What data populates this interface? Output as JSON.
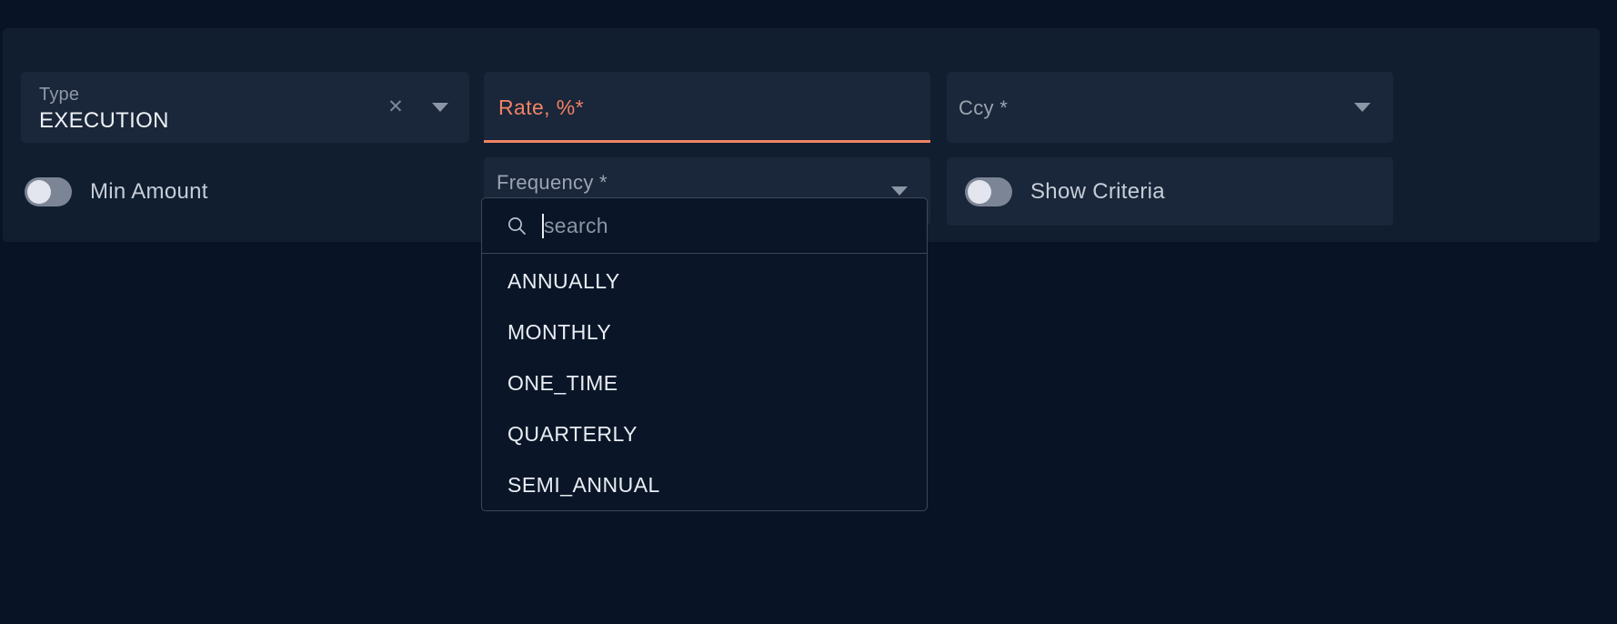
{
  "theme": {
    "page_background": "#081426",
    "panel_background": "#111e30",
    "field_background": "#1a2639",
    "dropdown_background": "#0a1628",
    "dropdown_border": "#3c4758",
    "error_accent": "#ef8364",
    "text_primary": "#eef1f6",
    "text_muted": "#8e99a8",
    "toggle_track": "#7b8595",
    "toggle_knob": "#e3e6ef"
  },
  "form": {
    "type_field": {
      "label": "Type",
      "value": "EXECUTION",
      "clear_icon": "close-icon",
      "caret_icon": "chevron-down-icon"
    },
    "rate_field": {
      "label": "Rate, %*",
      "value": "",
      "state": "error"
    },
    "ccy_field": {
      "placeholder": "Ccy *",
      "value": "",
      "caret_icon": "chevron-down-icon"
    },
    "min_amount_toggle": {
      "label": "Min Amount",
      "checked": false
    },
    "frequency_field": {
      "placeholder": "Frequency *",
      "value": "",
      "caret_icon": "chevron-down-icon",
      "expanded": true
    },
    "show_criteria_toggle": {
      "label": "Show Criteria",
      "checked": false
    }
  },
  "frequency_dropdown": {
    "search": {
      "placeholder": "search",
      "value": "",
      "icon": "search-icon"
    },
    "options": [
      {
        "label": "ANNUALLY"
      },
      {
        "label": "MONTHLY"
      },
      {
        "label": "ONE_TIME"
      },
      {
        "label": "QUARTERLY"
      },
      {
        "label": "SEMI_ANNUAL"
      }
    ]
  }
}
